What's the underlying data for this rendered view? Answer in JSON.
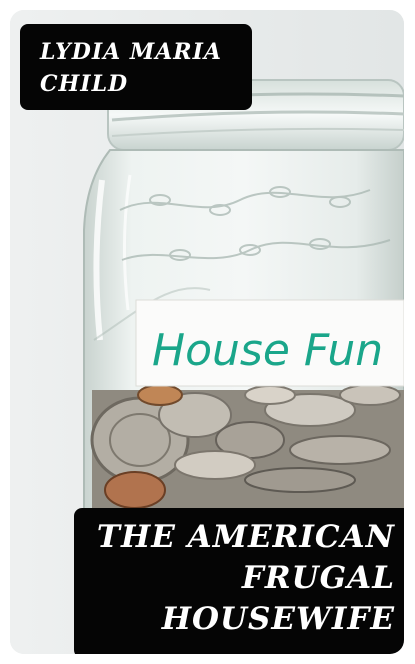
{
  "cover": {
    "author": "Lydia Maria Child",
    "title_lines": [
      "THE AMERICAN",
      "FRUGAL",
      "HOUSEWIFE"
    ],
    "jar_label_text": "House Fun"
  },
  "colors": {
    "background": "#e9ecec",
    "text_box": "#050505",
    "text": "#ffffff",
    "label_ink": "#1aa68a"
  }
}
